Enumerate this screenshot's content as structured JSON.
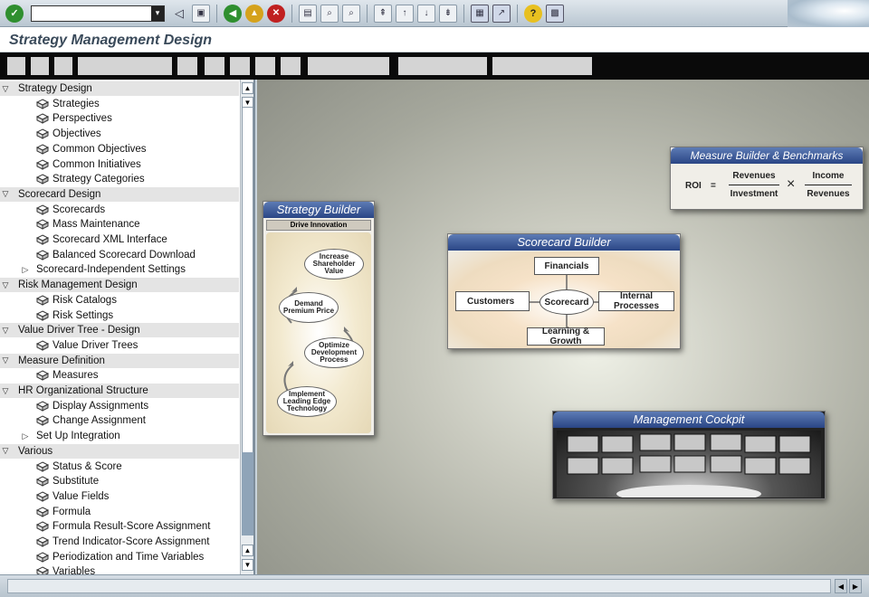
{
  "window": {
    "title": "Strategy Management Design",
    "command_field_value": ""
  },
  "toolbar": {
    "icons": [
      "enter-icon",
      "command-field",
      "back-arrow-icon",
      "save-icon",
      "back-icon",
      "exit-icon",
      "cancel-icon",
      "print-icon",
      "find-icon",
      "find-next-icon",
      "first-page-icon",
      "previous-page-icon",
      "next-page-icon",
      "last-page-icon",
      "create-session-icon",
      "shortcut-icon",
      "help-icon",
      "layout-menu-icon"
    ]
  },
  "tree": {
    "groups": [
      {
        "label": "Strategy Design",
        "items": [
          "Strategies",
          "Perspectives",
          "Objectives",
          "Common Objectives",
          "Common Initiatives",
          "Strategy Categories"
        ]
      },
      {
        "label": "Scorecard Design",
        "items": [
          "Scorecards",
          "Mass Maintenance",
          "Scorecard XML Interface",
          "Balanced Scorecard Download"
        ],
        "subfolders": [
          "Scorecard-Independent Settings"
        ]
      },
      {
        "label": "Risk Management Design",
        "items": [
          "Risk Catalogs",
          "Risk Settings"
        ]
      },
      {
        "label": "Value Driver Tree - Design",
        "items": [
          "Value Driver Trees"
        ]
      },
      {
        "label": "Measure Definition",
        "items": [
          "Measures"
        ]
      },
      {
        "label": "HR Organizational Structure",
        "items": [
          "Display Assignments",
          "Change Assignment"
        ],
        "subfolders": [
          "Set Up Integration"
        ]
      },
      {
        "label": "Various",
        "items": [
          "Status & Score",
          "Substitute",
          "Value Fields",
          "Formula",
          "Formula Result-Score Assignment",
          "Trend Indicator-Score Assignment",
          "Periodization and Time Variables",
          "Variables"
        ]
      }
    ]
  },
  "strategy_builder": {
    "title": "Strategy Builder",
    "subtitle": "Drive Innovation",
    "steps": [
      "Increase Shareholder Value",
      "Demand Premium Price",
      "Optimize Development Process",
      "Implement Leading Edge Technology"
    ]
  },
  "measure_builder": {
    "title": "Measure Builder & Benchmarks",
    "formula": {
      "lhs": "ROI",
      "equals": "=",
      "num1": "Revenues",
      "den1": "Investment",
      "times": "×",
      "num2": "Income",
      "den2": "Revenues"
    }
  },
  "scorecard_builder": {
    "title": "Scorecard Builder",
    "center": "Scorecard",
    "top": "Financials",
    "left": "Customers",
    "right": "Internal Processes",
    "bottom": "Learning & Growth"
  },
  "management_cockpit": {
    "title": "Management Cockpit"
  },
  "colors": {
    "panel_header": "#2a4585",
    "tree_folder_bg": "#e4e4e4",
    "app_toolbar": "#0a0a0a"
  }
}
